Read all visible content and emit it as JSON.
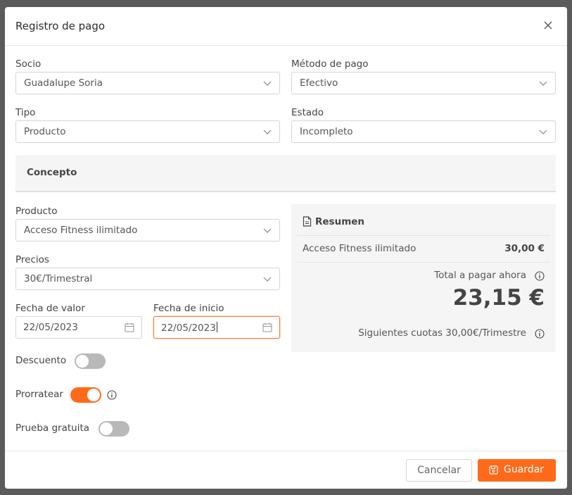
{
  "modal": {
    "title": "Registro de pago",
    "close_icon": "close-icon"
  },
  "form": {
    "socio": {
      "label": "Socio",
      "value": "Guadalupe Soria"
    },
    "metodo_pago": {
      "label": "Método de pago",
      "value": "Efectivo"
    },
    "tipo": {
      "label": "Tipo",
      "value": "Producto"
    },
    "estado": {
      "label": "Estado",
      "value": "Incompleto"
    },
    "concepto_heading": "Concepto",
    "producto": {
      "label": "Producto",
      "value": "Acceso Fitness ilimitado"
    },
    "precios": {
      "label": "Precios",
      "value": "30€/Trimestral"
    },
    "fecha_valor": {
      "label": "Fecha de valor",
      "value": "22/05/2023"
    },
    "fecha_inicio": {
      "label": "Fecha de inicio",
      "value": "22/05/2023"
    },
    "descuento": {
      "label": "Descuento",
      "on": false
    },
    "prorratear": {
      "label": "Prorratear",
      "on": true
    },
    "prueba_gratuita": {
      "label": "Prueba gratuita",
      "on": false
    }
  },
  "summary": {
    "title": "Resumen",
    "item_name": "Acceso Fitness ilimitado",
    "item_price": "30,00 €",
    "total_label": "Total a pagar ahora",
    "total_value": "23,15 €",
    "next_label": "Siguientes cuotas 30,00€/Trimestre"
  },
  "footer": {
    "cancel_label": "Cancelar",
    "save_label": "Guardar"
  },
  "colors": {
    "accent": "#ff6a1a",
    "overlay": "#5b5b5b",
    "panel": "#f5f5f5"
  }
}
